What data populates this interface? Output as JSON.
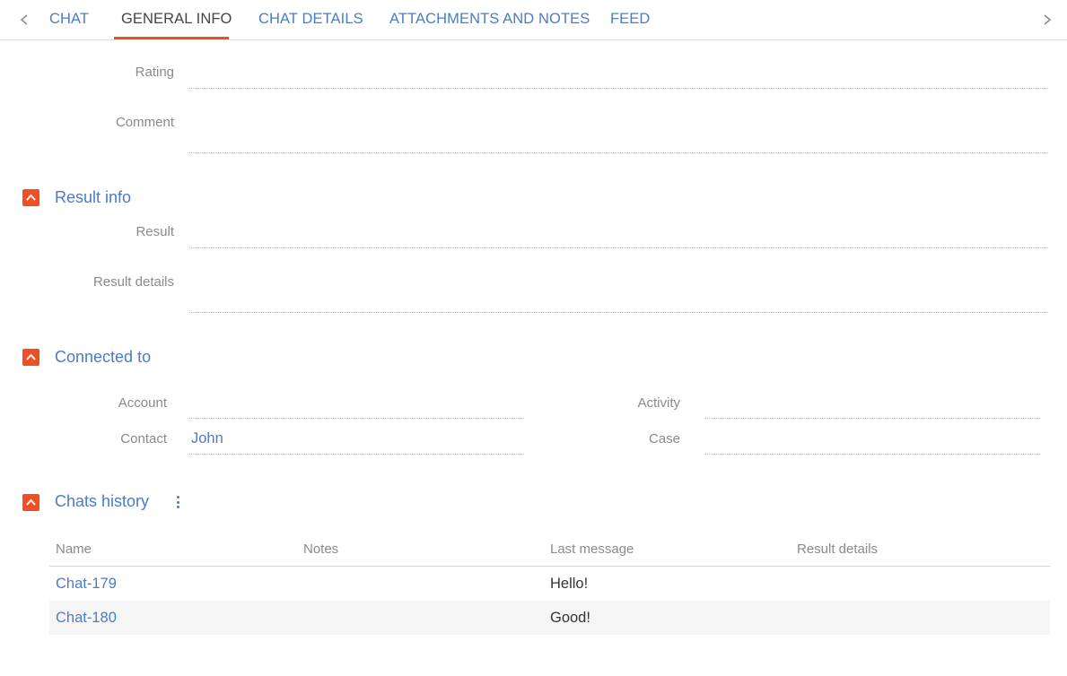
{
  "tabs": [
    {
      "label": "CHAT",
      "active": false
    },
    {
      "label": "GENERAL INFO",
      "active": true
    },
    {
      "label": "CHAT DETAILS",
      "active": false
    },
    {
      "label": "ATTACHMENTS AND NOTES",
      "active": false
    },
    {
      "label": "FEED",
      "active": false
    }
  ],
  "icons": {
    "tab_prev": "chevron-left-icon",
    "tab_next": "chevron-right-icon",
    "section_toggle": "chevron-up-icon",
    "menu": "kebab-menu-icon"
  },
  "colors": {
    "accent": "#f04e23",
    "link": "#4b7cc7",
    "label": "#8a8a8a"
  },
  "rating_section": {
    "rating_label": "Rating",
    "rating_value": "",
    "comment_label": "Comment",
    "comment_value": ""
  },
  "result_info": {
    "title": "Result info",
    "result_label": "Result",
    "result_value": "",
    "details_label": "Result details",
    "details_value": ""
  },
  "connected_to": {
    "title": "Connected to",
    "account_label": "Account",
    "account_value": "",
    "contact_label": "Contact",
    "contact_value": "John",
    "activity_label": "Activity",
    "activity_value": "",
    "case_label": "Case",
    "case_value": ""
  },
  "chats_history": {
    "title": "Chats history",
    "columns": [
      "Name",
      "Notes",
      "Last message",
      "Result details"
    ],
    "rows": [
      {
        "name": "Chat-179",
        "notes": "",
        "last_message": "Hello!",
        "result_details": ""
      },
      {
        "name": "Chat-180",
        "notes": "",
        "last_message": "Good!",
        "result_details": ""
      }
    ]
  }
}
